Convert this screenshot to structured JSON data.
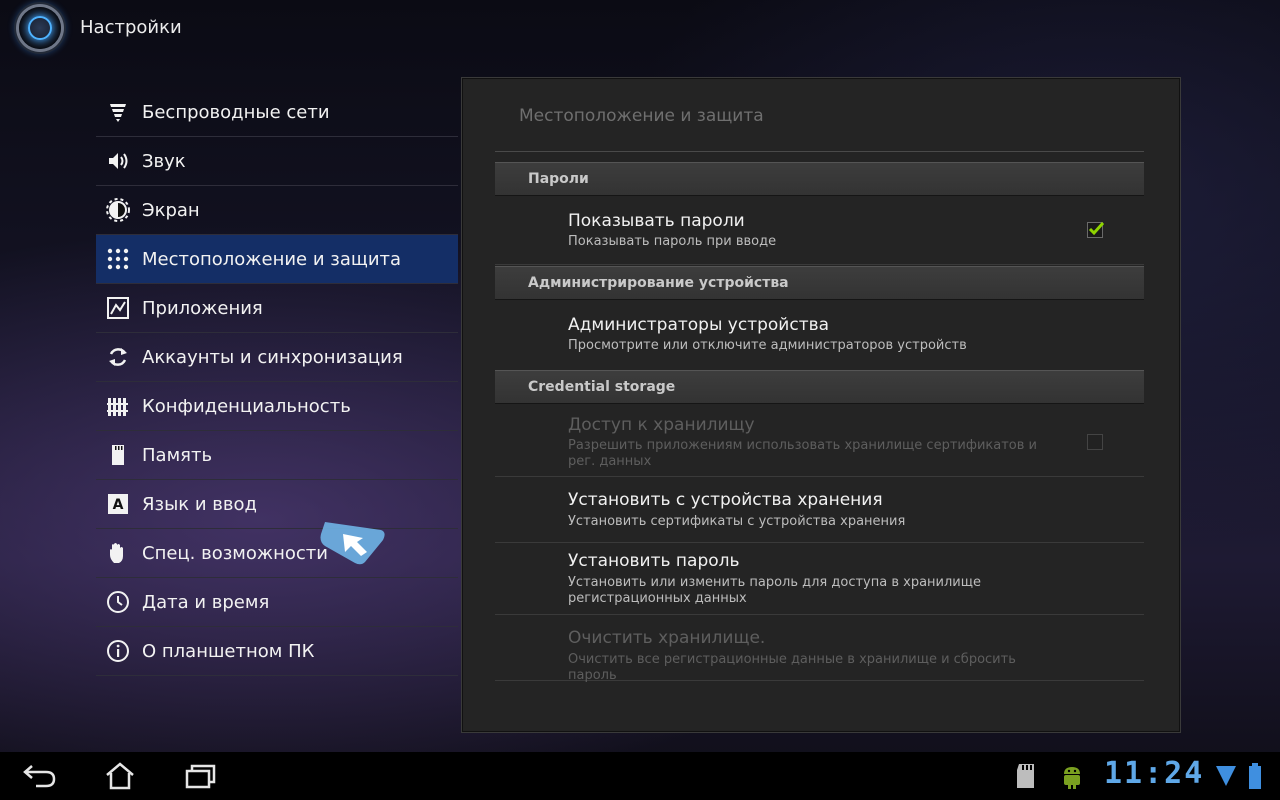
{
  "app": {
    "title": "Настройки"
  },
  "menu": {
    "selected_index": 3,
    "items": [
      {
        "label": "Беспроводные сети",
        "icon": "wifi-icon"
      },
      {
        "label": "Звук",
        "icon": "speaker-icon"
      },
      {
        "label": "Экран",
        "icon": "brightness-icon"
      },
      {
        "label": "Местоположение и защита",
        "icon": "lock-pattern-icon"
      },
      {
        "label": "Приложения",
        "icon": "apps-icon"
      },
      {
        "label": "Аккаунты и синхронизация",
        "icon": "sync-icon"
      },
      {
        "label": "Конфиденциальность",
        "icon": "privacy-fence-icon"
      },
      {
        "label": "Память",
        "icon": "sd-card-icon"
      },
      {
        "label": "Язык и ввод",
        "icon": "language-icon"
      },
      {
        "label": "Спец. возможности",
        "icon": "hand-icon"
      },
      {
        "label": "Дата и время",
        "icon": "clock-icon"
      },
      {
        "label": "О планшетном ПК",
        "icon": "info-icon"
      }
    ]
  },
  "panel": {
    "title": "Местоположение и защита",
    "sections": {
      "passwords": {
        "header": "Пароли",
        "show_passwords": {
          "title": "Показывать пароли",
          "summary": "Показывать пароль при вводе",
          "checked": true
        }
      },
      "device_admin": {
        "header": "Администрирование устройства",
        "admins": {
          "title": "Администраторы устройства",
          "summary": "Просмотрите или отключите администраторов устройств"
        }
      },
      "credentials": {
        "header": "Credential storage",
        "access": {
          "title": "Доступ к хранилищу",
          "summary": "Разрешить приложениям использовать хранилище сертификатов и рег. данных",
          "checked": false,
          "enabled": false
        },
        "install": {
          "title": "Установить с устройства хранения",
          "summary": "Установить сертификаты с устройства хранения"
        },
        "set_password": {
          "title": "Установить пароль",
          "summary": "Установить или изменить пароль для доступа в хранилище регистрационных данных"
        },
        "clear": {
          "title": "Очистить хранилище.",
          "summary": "Очистить все регистрационные данные в хранилище и сбросить пароль",
          "enabled": false
        }
      }
    }
  },
  "system_bar": {
    "time": "11:24",
    "icons": [
      "back-icon",
      "home-icon",
      "recent-apps-icon",
      "sd-card-icon",
      "android-debug-icon",
      "wifi-signal-icon",
      "battery-icon"
    ]
  },
  "colors": {
    "accent": "#142e66",
    "clock": "#5fa8e8",
    "check": "#8fd400"
  }
}
